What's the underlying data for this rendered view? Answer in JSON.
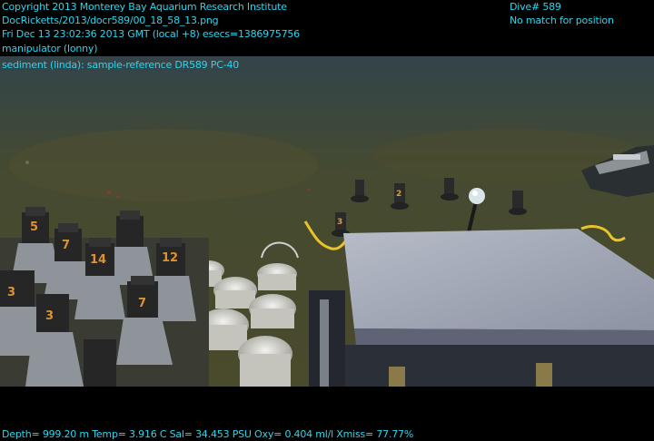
{
  "overlay": {
    "copyright": "Copyright 2013 Monterey Bay Aquarium Research Institute",
    "file_path": "DocRicketts/2013/docr589/00_18_58_13.png",
    "timestamp": "Fri Dec 13 23:02:36 2013 GMT (local +8)  esecs=1386975756",
    "manipulator": "manipulator (lonny)",
    "sample_note": "sediment (linda): sample-reference DR589 PC-40",
    "dive_number": "Dive# 589",
    "position_status": "No match for position",
    "telemetry": "Depth= 999.20 m  Temp= 3.916 C  Sal= 34.453 PSU  Oxy= 0.404 ml/l  Xmiss= 77.77%"
  },
  "scene": {
    "tube_labels": [
      "5",
      "7",
      "14",
      "12",
      "7",
      "3",
      "3"
    ],
    "core_labels": [
      "3",
      "2"
    ],
    "colors": {
      "seafloor": "#4a4a2e",
      "water_top": "#3c4a4a",
      "overlay_text": "#29d6ee",
      "tube_label": "#e0922e",
      "yellow_line": "#e8c42a"
    }
  }
}
